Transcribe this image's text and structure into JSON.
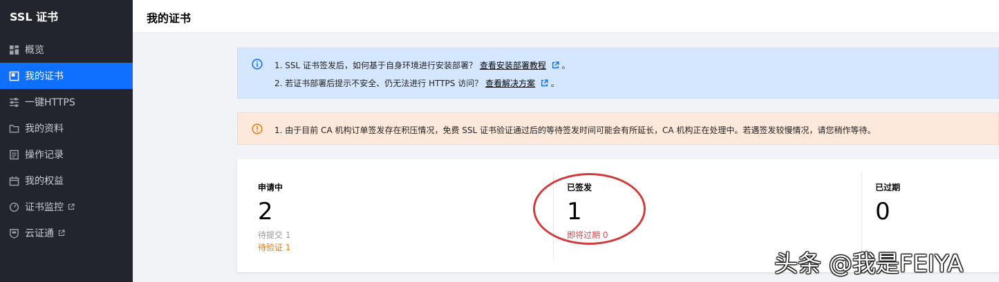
{
  "sidebar": {
    "brand": "SSL 证书",
    "items": [
      {
        "label": "概览",
        "icon": "grid-icon"
      },
      {
        "label": "我的证书",
        "icon": "certificate-icon",
        "active": true
      },
      {
        "label": "一键HTTPS",
        "icon": "sliders-icon"
      },
      {
        "label": "我的资料",
        "icon": "folder-icon"
      },
      {
        "label": "操作记录",
        "icon": "record-list-icon"
      },
      {
        "label": "我的权益",
        "icon": "calendar-gift-icon"
      },
      {
        "label": "证书监控",
        "icon": "monitor-gauge-icon",
        "external": true
      },
      {
        "label": "云证通",
        "icon": "shield-icon",
        "external": true
      }
    ]
  },
  "header": {
    "title": "我的证书"
  },
  "info_alert": {
    "line1_text": "1. SSL 证书签发后，如何基于自身环境进行安装部署？",
    "line1_link": "查看安装部署教程",
    "line1_end": "。",
    "line2_text": "2. 若证书部署后提示不安全、仍无法进行 HTTPS 访问？",
    "line2_link": "查看解决方案",
    "line2_end": "。"
  },
  "warn_alert": {
    "line1_text": "1. 由于目前 CA 机构订单签发存在积压情况，免费 SSL 证书验证通过后的等待签发时间可能会有所延长，CA 机构正在处理中。若遇签发较慢情况，请您稍作等待。"
  },
  "stats": {
    "applying": {
      "label": "申请中",
      "count": "2",
      "sub1": "待提交 1",
      "sub2": "待验证 1"
    },
    "issued": {
      "label": "已签发",
      "count": "1",
      "sub1": "即将过期 0"
    },
    "expired": {
      "label": "已过期",
      "count": "0"
    }
  },
  "watermark": "头条 @我是FEIYA",
  "colors": {
    "sidebar_bg": "#22252e",
    "active_item": "#0f6fff",
    "info_bg": "#d5e7ff",
    "warn_bg": "#fde8dc",
    "annotation_circle": "#d23a3a"
  }
}
